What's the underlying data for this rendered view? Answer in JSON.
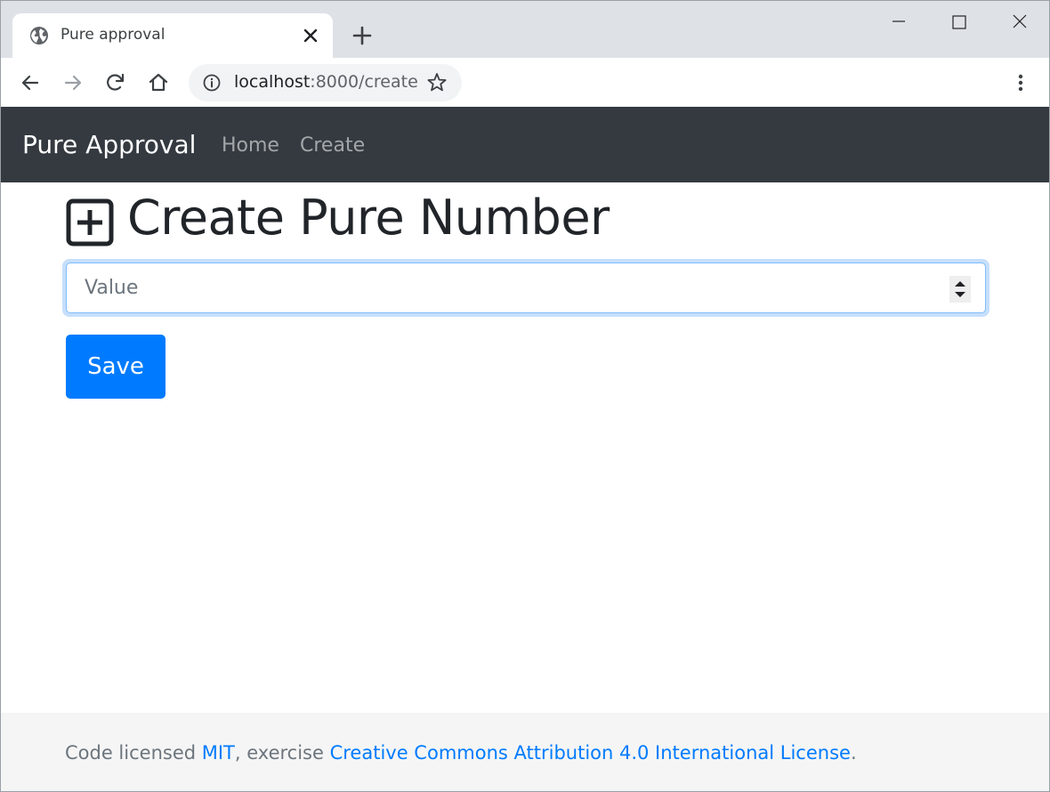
{
  "browser": {
    "tab_title": "Pure approval",
    "url_host": "localhost",
    "url_rest": ":8000/create"
  },
  "navbar": {
    "brand": "Pure Approval",
    "links": [
      {
        "label": "Home"
      },
      {
        "label": "Create"
      }
    ]
  },
  "main": {
    "title": "Create Pure Number",
    "value_input": {
      "placeholder": "Value",
      "value": ""
    },
    "save_label": "Save"
  },
  "footer": {
    "prefix": "Code licensed ",
    "mit_link": "MIT",
    "middle": ", exercise ",
    "cc_link": "Creative Commons Attribution 4.0 International License",
    "suffix": "."
  },
  "colors": {
    "navbar_bg": "#343a40",
    "primary": "#007bff",
    "footer_bg": "#f5f5f5",
    "tabstrip_bg": "#dee1e6"
  }
}
